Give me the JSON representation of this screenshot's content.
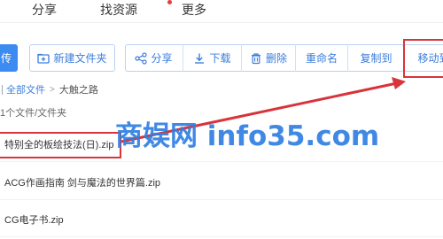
{
  "top_nav": {
    "items": [
      "分享",
      "找资源",
      "更多"
    ]
  },
  "toolbar": {
    "upload_label": "传",
    "new_folder_label": "新建文件夹",
    "share_label": "分享",
    "download_label": "下载",
    "delete_label": "删除",
    "rename_label": "重命名",
    "copy_to_label": "复制到",
    "move_to_label": "移动到"
  },
  "breadcrumb": {
    "root": "全部文件",
    "current": "大触之路"
  },
  "file_list": {
    "count_text": "1个文件/文件夹",
    "files": [
      "特别全的板绘技法(日).zip",
      "ACG作画指南 剑与魔法的世界篇.zip",
      "CG电子书.zip"
    ]
  },
  "watermark": "商娱网 info35.com",
  "colors": {
    "accent": "#3b7ddc",
    "highlight": "#d8343b",
    "watermark": "#2f7fe3"
  },
  "icons": {
    "new_folder": "folder-plus-icon",
    "share": "share-icon",
    "download": "download-icon",
    "delete": "trash-icon"
  }
}
